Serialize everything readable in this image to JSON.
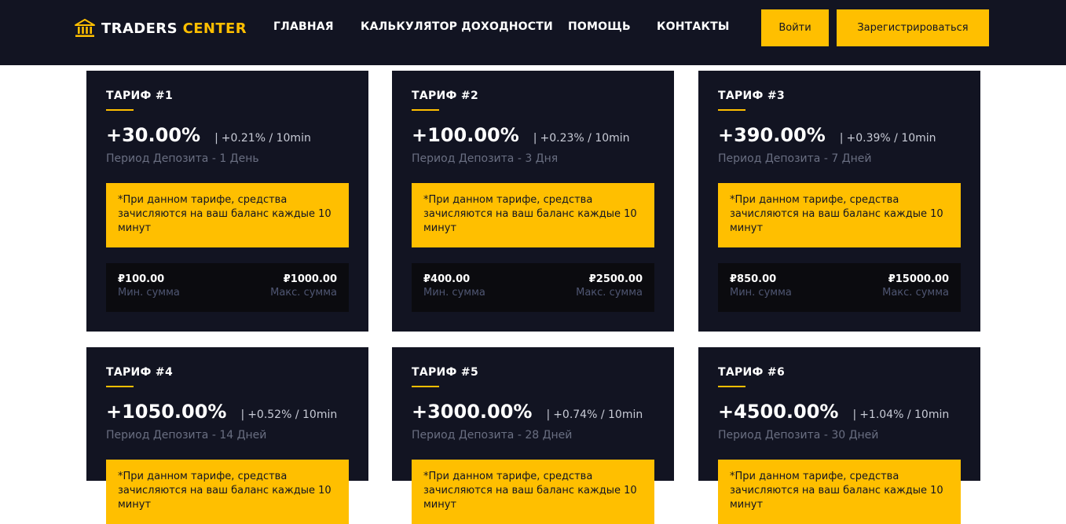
{
  "header": {
    "logo_main": "TRADERS",
    "logo_accent": "CENTER",
    "nav": [
      "ГЛАВНАЯ",
      "КАЛЬКУЛЯТОР ДОХОДНОСТИ",
      "ПОМОЩЬ",
      "КОНТАКТЫ"
    ],
    "login_label": "Войти",
    "register_label": "Зарегистрироваться"
  },
  "colors": {
    "dark": "#121422",
    "accent": "#ffbf00",
    "muted": "#6a6f82",
    "amount_bg": "#0b0b0f"
  },
  "icons": {
    "logo": "bank-building-icon"
  },
  "separator": "|",
  "tariffs": [
    {
      "title": "ТАРИФ #1",
      "total": "+30.00%",
      "rate": "+0.21% / 10min",
      "period": "Период Депозита - 1 День",
      "note": "*При данном тарифе, средства зачисляются на ваш баланс каждые 10 минут",
      "min": "₽100.00",
      "max": "₽1000.00",
      "min_label": "Мин. сумма",
      "max_label": "Макс. сумма"
    },
    {
      "title": "ТАРИФ #2",
      "total": "+100.00%",
      "rate": "+0.23% / 10min",
      "period": "Период Депозита - 3 Дня",
      "note": "*При данном тарифе, средства зачисляются на ваш баланс каждые 10 минут",
      "min": "₽400.00",
      "max": "₽2500.00",
      "min_label": "Мин. сумма",
      "max_label": "Макс. сумма"
    },
    {
      "title": "ТАРИФ #3",
      "total": "+390.00%",
      "rate": "+0.39% / 10min",
      "period": "Период Депозита - 7 Дней",
      "note": "*При данном тарифе, средства зачисляются на ваш баланс каждые 10 минут",
      "min": "₽850.00",
      "max": "₽15000.00",
      "min_label": "Мин. сумма",
      "max_label": "Макс. сумма"
    },
    {
      "title": "ТАРИФ #4",
      "total": "+1050.00%",
      "rate": "+0.52% / 10min",
      "period": "Период Депозита - 14 Дней",
      "note": "*При данном тарифе, средства зачисляются на ваш баланс каждые 10 минут",
      "min": "",
      "max": "",
      "min_label": "",
      "max_label": ""
    },
    {
      "title": "ТАРИФ #5",
      "total": "+3000.00%",
      "rate": "+0.74% / 10min",
      "period": "Период Депозита - 28 Дней",
      "note": "*При данном тарифе, средства зачисляются на ваш баланс каждые 10 минут",
      "min": "",
      "max": "",
      "min_label": "",
      "max_label": ""
    },
    {
      "title": "ТАРИФ #6",
      "total": "+4500.00%",
      "rate": "+1.04% / 10min",
      "period": "Период Депозита - 30 Дней",
      "note": "*При данном тарифе, средства зачисляются на ваш баланс каждые 10 минут",
      "min": "",
      "max": "",
      "min_label": "",
      "max_label": ""
    }
  ]
}
